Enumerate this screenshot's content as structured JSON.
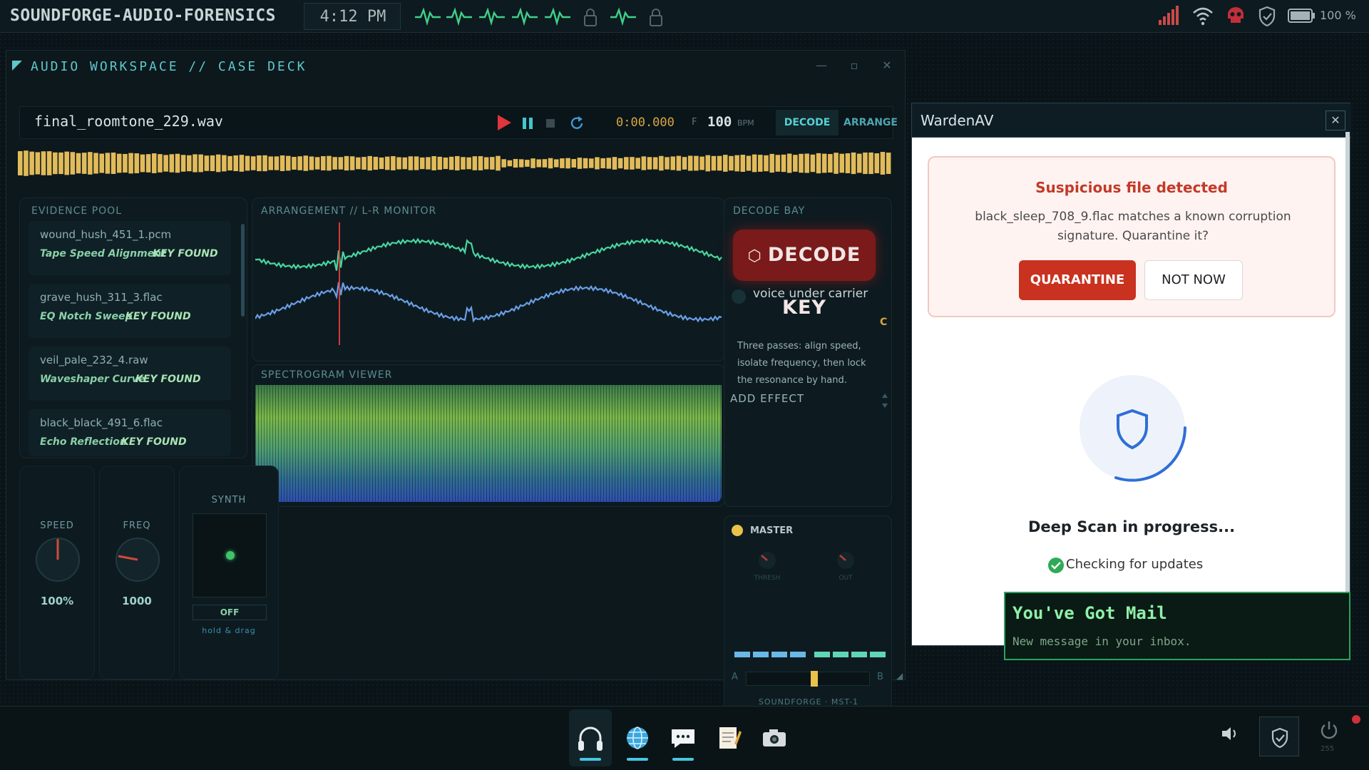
{
  "os": {
    "title": "SOUNDFORGE-AUDIO-FORENSICS",
    "clock": "4:12 PM",
    "battery": "100 %"
  },
  "workspace": {
    "title": "AUDIO WORKSPACE // CASE DECK",
    "filename": "final_roomtone_229.wav",
    "timecode": "0:00.000",
    "bpm_prefix": "F",
    "bpm": "100",
    "bpm_unit": "BPM",
    "tabs": {
      "decode": "DECODE",
      "arrange": "ARRANGE"
    }
  },
  "evidence": {
    "label": "EVIDENCE POOL",
    "items": [
      {
        "name": "wound_hush_451_1.pcm",
        "effect": "Tape Speed Alignment",
        "status": "KEY FOUND"
      },
      {
        "name": "grave_hush_311_3.flac",
        "effect": "EQ Notch Sweep",
        "status": "KEY FOUND"
      },
      {
        "name": "veil_pale_232_4.raw",
        "effect": "Waveshaper Curve",
        "status": "KEY FOUND"
      },
      {
        "name": "black_black_491_6.flac",
        "effect": "Echo Reflection",
        "status": "KEY FOUND"
      }
    ]
  },
  "arrangement": {
    "label": "ARRANGEMENT // L-R MONITOR"
  },
  "spectrogram": {
    "label": "SPECTROGRAM VIEWER"
  },
  "decode_bay": {
    "label": "DECODE BAY",
    "button": "DECODE KEY",
    "hint": "voice under carrier",
    "corner": "C",
    "desc": "Three passes: align speed, isolate frequency, then lock the resonance by hand.",
    "add_effect": "ADD EFFECT"
  },
  "knobs": {
    "speed": {
      "label": "SPEED",
      "value": "100%"
    },
    "freq": {
      "label": "FREQ",
      "value": "1000"
    },
    "synth": {
      "label": "SYNTH",
      "toggle": "OFF",
      "hint": "hold & drag"
    }
  },
  "master": {
    "label": "MASTER",
    "thresh": "THRESH",
    "out": "OUT",
    "a": "A",
    "b": "B",
    "brand": "SOUNDFORGE · MST-1",
    "crossfade": 0.55
  },
  "warden": {
    "title": "WardenAV",
    "alert_title": "Suspicious file detected",
    "alert_msg": "black_sleep_708_9.flac matches a known corruption signature. Quarantine it?",
    "quarantine": "QUARANTINE",
    "not_now": "NOT NOW",
    "scan_title": "Deep Scan in progress...",
    "scan_step": "Checking for updates"
  },
  "mail": {
    "title": "You've Got Mail",
    "msg": "New message in your inbox."
  },
  "taskbar": {
    "power_sub": "255"
  },
  "colors": {
    "accent": "#5fc7cc",
    "waveform_top": "#49d6a0",
    "waveform_bottom": "#6a9ee6",
    "alert": "#c8321f",
    "mail": "#2aa45a"
  }
}
